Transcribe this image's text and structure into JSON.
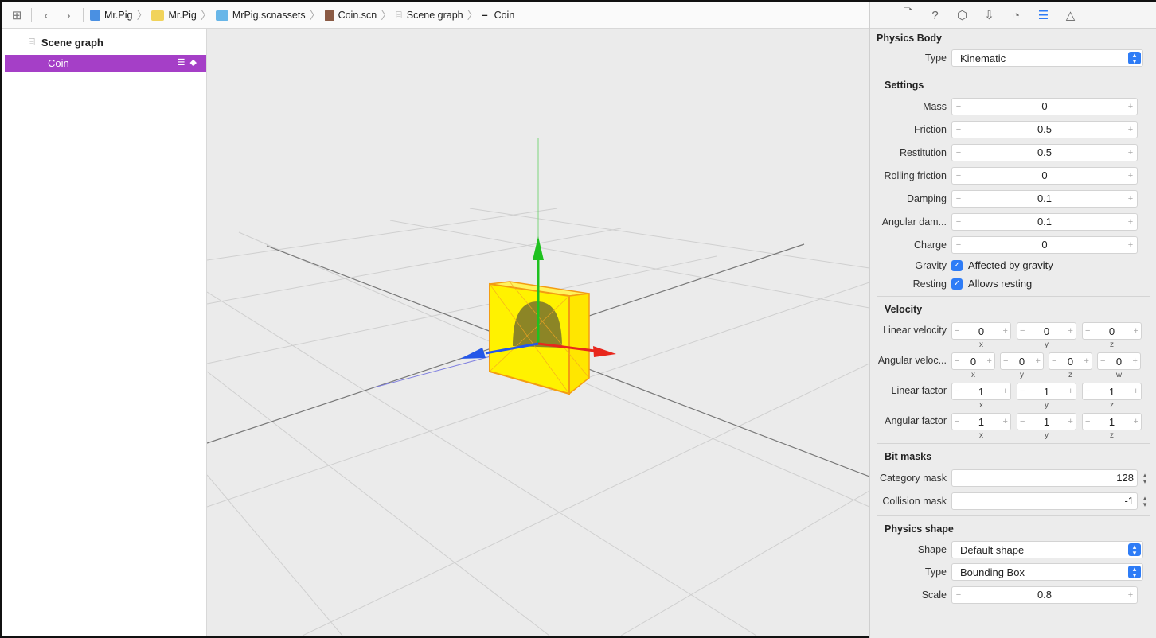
{
  "toolbar": {
    "breadcrumbs": [
      {
        "label": "Mr.Pig",
        "icon": "project-icon",
        "color": "#4a90e2"
      },
      {
        "label": "Mr.Pig",
        "icon": "folder-icon",
        "color": "#f1d35a"
      },
      {
        "label": "MrPig.scnassets",
        "icon": "blue-folder-icon",
        "color": "#68b6e8"
      },
      {
        "label": "Coin.scn",
        "icon": "scene-file-icon",
        "color": "#8a5a44"
      },
      {
        "label": "Scene graph",
        "icon": "scene-graph-icon",
        "color": "#999999"
      },
      {
        "label": "Coin",
        "icon": "node-dash-icon",
        "color": "#111111"
      }
    ]
  },
  "navigator": {
    "header": "Scene graph",
    "items": [
      {
        "label": "Coin",
        "selected": true
      }
    ]
  },
  "inspector": {
    "physics_body_title": "Physics Body",
    "type_label": "Type",
    "type_value": "Kinematic",
    "settings_title": "Settings",
    "settings": [
      {
        "label": "Mass",
        "value": "0"
      },
      {
        "label": "Friction",
        "value": "0.5"
      },
      {
        "label": "Restitution",
        "value": "0.5"
      },
      {
        "label": "Rolling friction",
        "value": "0"
      },
      {
        "label": "Damping",
        "value": "0.1"
      },
      {
        "label": "Angular dam...",
        "value": "0.1"
      },
      {
        "label": "Charge",
        "value": "0"
      }
    ],
    "gravity_label": "Gravity",
    "gravity_text": "Affected by gravity",
    "resting_label": "Resting",
    "resting_text": "Allows resting",
    "velocity_title": "Velocity",
    "linear_velocity": {
      "label": "Linear velocity",
      "x": "0",
      "y": "0",
      "z": "0"
    },
    "angular_velocity": {
      "label": "Angular veloc...",
      "x": "0",
      "y": "0",
      "z": "0",
      "w": "0"
    },
    "linear_factor": {
      "label": "Linear factor",
      "x": "1",
      "y": "1",
      "z": "1"
    },
    "angular_factor": {
      "label": "Angular factor",
      "x": "1",
      "y": "1",
      "z": "1"
    },
    "comp_labels": {
      "x": "x",
      "y": "y",
      "z": "z",
      "w": "w"
    },
    "bitmasks_title": "Bit masks",
    "category_mask_label": "Category mask",
    "category_mask_value": "128",
    "collision_mask_label": "Collision mask",
    "collision_mask_value": "-1",
    "shape_title": "Physics shape",
    "shape_label": "Shape",
    "shape_value": "Default shape",
    "shape_type_label": "Type",
    "shape_type_value": "Bounding Box",
    "scale_label": "Scale",
    "scale_value": "0.8",
    "minus": "−",
    "plus": "+"
  },
  "colors": {
    "selection": "#a53fc7",
    "accent": "#2e7cf6",
    "axis_x": "#e8271d",
    "axis_y": "#1fc11f",
    "axis_z": "#2557e8",
    "coin_box": "#fff200"
  }
}
